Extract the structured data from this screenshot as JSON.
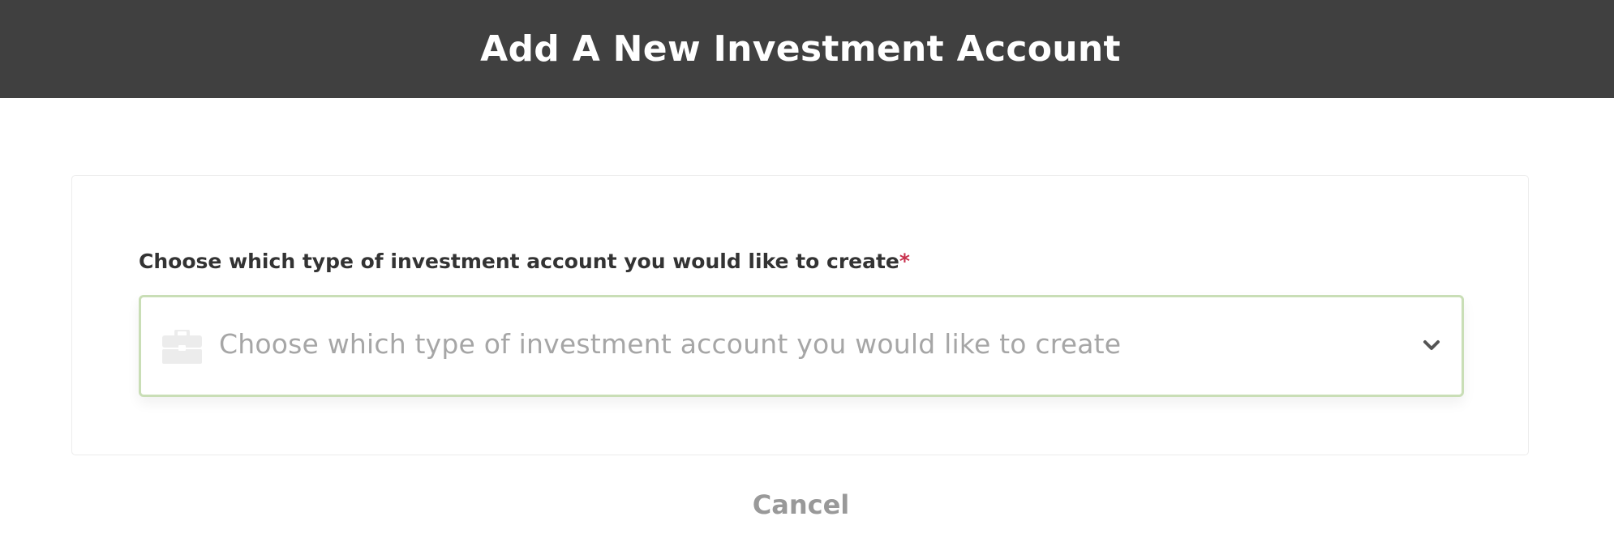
{
  "header": {
    "title": "Add A New Investment Account"
  },
  "form": {
    "account_type_label": "Choose which type of investment account you would like to create",
    "required_marker": "*",
    "account_type_select": {
      "placeholder": "Choose which type of investment account you would like to create",
      "leading_icon": "briefcase-icon",
      "trailing_icon": "chevron-down-icon"
    }
  },
  "actions": {
    "cancel_label": "Cancel"
  },
  "colors": {
    "header_bg": "#404040",
    "select_border": "#c9deb6",
    "required": "#c8314d",
    "placeholder_text": "#a6a6a6",
    "cancel_text": "#999999"
  }
}
